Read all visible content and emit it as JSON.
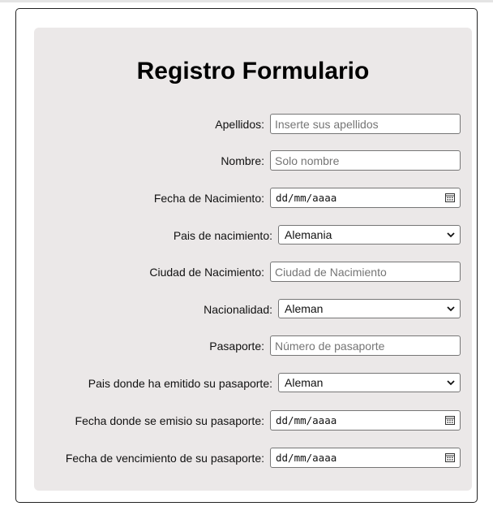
{
  "form": {
    "title": "Registro Formulario",
    "fields": {
      "apellidos": {
        "label": "Apellidos:",
        "placeholder": "Inserte sus apellidos",
        "value": ""
      },
      "nombre": {
        "label": "Nombre:",
        "placeholder": "Solo nombre",
        "value": ""
      },
      "fecha_nacimiento": {
        "label": "Fecha de Nacimiento:",
        "value": "dd/mm/aaaa",
        "icon": "calendar-icon"
      },
      "pais_nacimiento": {
        "label": "Pais de nacimiento:",
        "value": "Alemania",
        "icon": "chevron-down-icon"
      },
      "ciudad_nacimiento": {
        "label": "Ciudad de Nacimiento:",
        "placeholder": "Ciudad de Nacimiento",
        "value": ""
      },
      "nacionalidad": {
        "label": "Nacionalidad:",
        "value": "Aleman",
        "icon": "chevron-down-icon"
      },
      "pasaporte": {
        "label": "Pasaporte:",
        "placeholder": "Número de pasaporte",
        "value": ""
      },
      "pais_emision": {
        "label": "Pais donde ha emitido su pasaporte:",
        "value": "Aleman",
        "icon": "chevron-down-icon"
      },
      "fecha_emision": {
        "label": "Fecha donde se emisio su pasaporte:",
        "value": "dd/mm/aaaa",
        "icon": "calendar-icon"
      },
      "fecha_vencimiento": {
        "label": "Fecha de vencimiento de su pasaporte:",
        "value": "dd/mm/aaaa",
        "icon": "calendar-icon"
      }
    }
  },
  "colors": {
    "panel_background": "#ebe8e8",
    "border": "#767676",
    "placeholder": "#757575"
  }
}
